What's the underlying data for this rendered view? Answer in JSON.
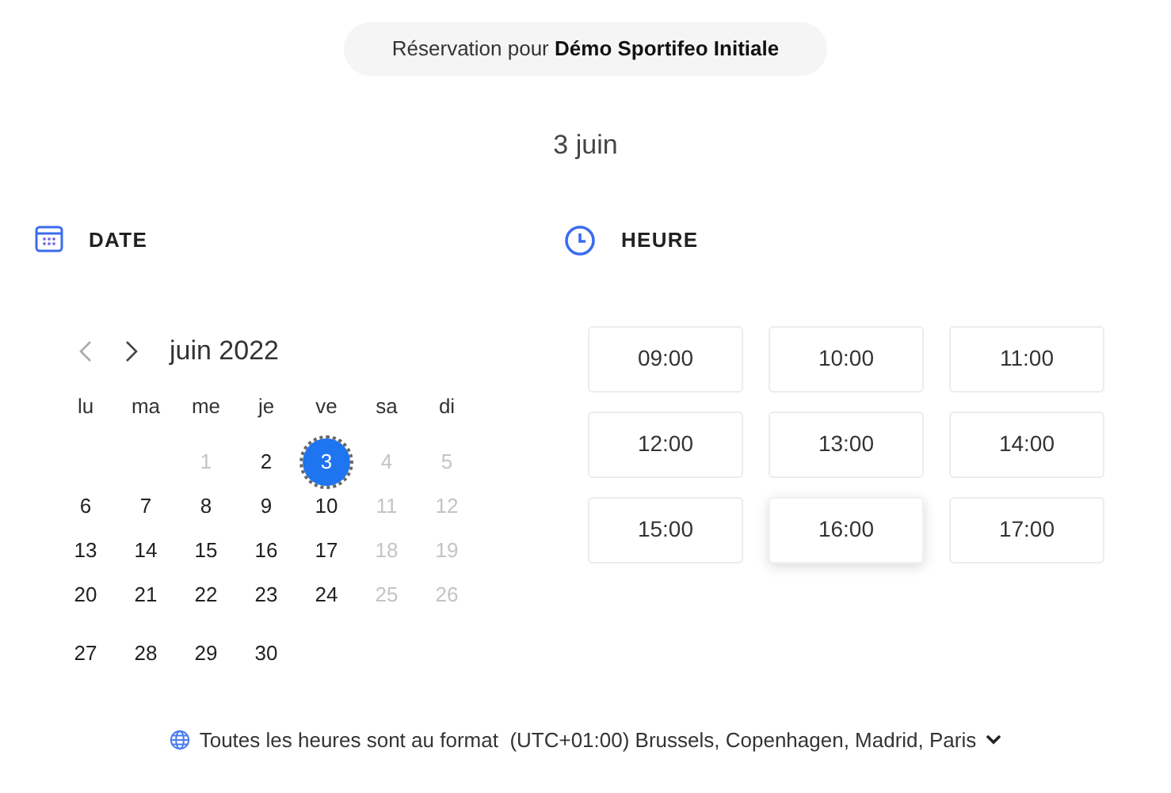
{
  "header": {
    "prefix": "Réservation pour",
    "venue": "Démo Sportifeo Initiale"
  },
  "selected_date": "3 juin",
  "date_section": {
    "title": "DATE"
  },
  "time_section": {
    "title": "HEURE"
  },
  "calendar": {
    "month": "juin 2022",
    "weekdays": [
      "lu",
      "ma",
      "me",
      "je",
      "ve",
      "sa",
      "di"
    ],
    "weeks": [
      [
        {
          "day": "1",
          "disabled": true,
          "selected": false
        },
        {
          "day": "2",
          "disabled": false,
          "selected": false
        },
        {
          "day": "3",
          "disabled": false,
          "selected": true
        },
        {
          "day": "4",
          "disabled": true,
          "selected": false
        },
        {
          "day": "5",
          "disabled": true,
          "selected": false
        }
      ],
      [
        {
          "day": "6",
          "disabled": false,
          "selected": false
        },
        {
          "day": "7",
          "disabled": false,
          "selected": false
        },
        {
          "day": "8",
          "disabled": false,
          "selected": false
        },
        {
          "day": "9",
          "disabled": false,
          "selected": false
        },
        {
          "day": "10",
          "disabled": false,
          "selected": false
        },
        {
          "day": "11",
          "disabled": true,
          "selected": false
        },
        {
          "day": "12",
          "disabled": true,
          "selected": false
        }
      ],
      [
        {
          "day": "13",
          "disabled": false,
          "selected": false
        },
        {
          "day": "14",
          "disabled": false,
          "selected": false
        },
        {
          "day": "15",
          "disabled": false,
          "selected": false
        },
        {
          "day": "16",
          "disabled": false,
          "selected": false
        },
        {
          "day": "17",
          "disabled": false,
          "selected": false
        },
        {
          "day": "18",
          "disabled": true,
          "selected": false
        },
        {
          "day": "19",
          "disabled": true,
          "selected": false
        }
      ],
      [
        {
          "day": "20",
          "disabled": false,
          "selected": false
        },
        {
          "day": "21",
          "disabled": false,
          "selected": false
        },
        {
          "day": "22",
          "disabled": false,
          "selected": false
        },
        {
          "day": "23",
          "disabled": false,
          "selected": false
        },
        {
          "day": "24",
          "disabled": false,
          "selected": false
        },
        {
          "day": "25",
          "disabled": true,
          "selected": false
        },
        {
          "day": "26",
          "disabled": true,
          "selected": false
        }
      ],
      [
        {
          "day": "27",
          "disabled": false,
          "selected": false
        },
        {
          "day": "28",
          "disabled": false,
          "selected": false
        },
        {
          "day": "29",
          "disabled": false,
          "selected": false
        },
        {
          "day": "30",
          "disabled": false,
          "selected": false
        }
      ]
    ]
  },
  "time_slots": [
    {
      "label": "09:00",
      "selected": false
    },
    {
      "label": "10:00",
      "selected": false
    },
    {
      "label": "11:00",
      "selected": false
    },
    {
      "label": "12:00",
      "selected": false
    },
    {
      "label": "13:00",
      "selected": false
    },
    {
      "label": "14:00",
      "selected": false
    },
    {
      "label": "15:00",
      "selected": false
    },
    {
      "label": "16:00",
      "selected": true
    },
    {
      "label": "17:00",
      "selected": false
    }
  ],
  "timezone": {
    "label": "Toutes les heures sont au format",
    "value": "(UTC+01:00) Brussels, Copenhagen, Madrid, Paris"
  }
}
